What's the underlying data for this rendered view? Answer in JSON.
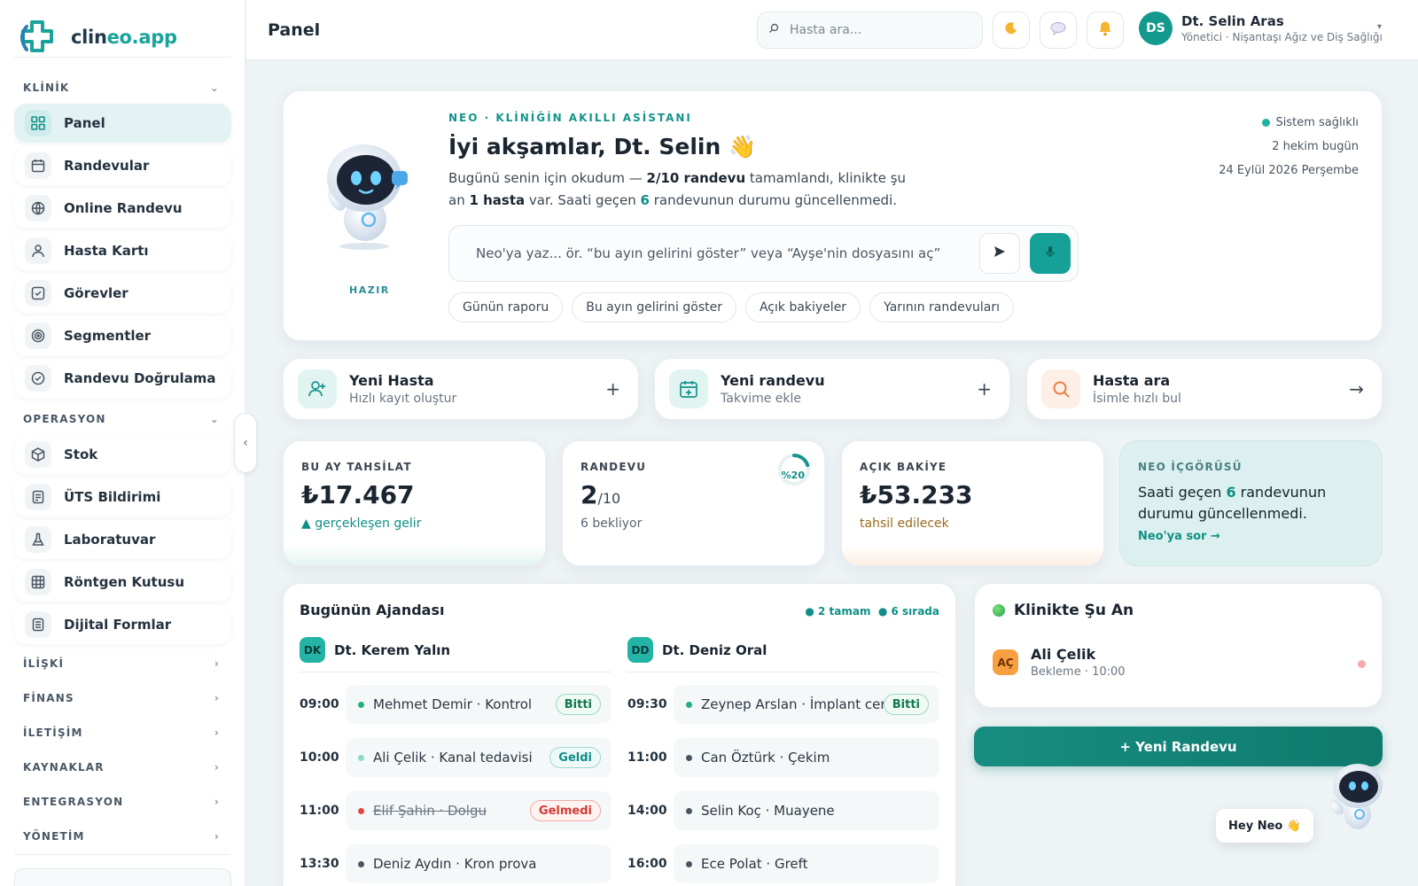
{
  "brand": {
    "name_a": "clin",
    "name_b": "eo.app"
  },
  "sidebar": {
    "sections": [
      {
        "label": "KLİNİK"
      },
      {
        "label": "OPERASYON"
      },
      {
        "label": "İLİŞKİ"
      },
      {
        "label": "FİNANS"
      },
      {
        "label": "İLETİŞİM"
      },
      {
        "label": "KAYNAKLAR"
      },
      {
        "label": "ENTEGRASYON"
      },
      {
        "label": "YÖNETİM"
      }
    ],
    "items": [
      {
        "label": "Panel",
        "icon": "dashboard-icon",
        "active": true
      },
      {
        "label": "Randevular",
        "icon": "calendar-icon"
      },
      {
        "label": "Online Randevu",
        "icon": "globe-icon"
      },
      {
        "label": "Hasta Kartı",
        "icon": "user-icon"
      },
      {
        "label": "Görevler",
        "icon": "checkbox-icon"
      },
      {
        "label": "Segmentler",
        "icon": "target-icon"
      },
      {
        "label": "Randevu Doğrulama",
        "icon": "check-circle-icon"
      },
      {
        "label": "Stok",
        "icon": "box-icon"
      },
      {
        "label": "ÜTS Bildirimi",
        "icon": "document-icon"
      },
      {
        "label": "Laboratuvar",
        "icon": "flask-icon"
      },
      {
        "label": "Röntgen Kutusu",
        "icon": "grid-icon"
      },
      {
        "label": "Dijital Formlar",
        "icon": "form-icon"
      }
    ]
  },
  "topbar": {
    "title": "Panel",
    "search_placeholder": "Hasta ara...",
    "user": {
      "initials": "DS",
      "name": "Dt. Selin Aras",
      "role": "Yönetici · Nişantaşı Ağız ve Diş Sağlığı"
    }
  },
  "hero": {
    "tag": "NEO · KLİNİĞİN AKILLI ASİSTANI",
    "greeting": "İyi akşamlar, Dt. Selin 👋",
    "desc_1": "Bugünü senin için okudum — ",
    "desc_2": "2/10 randevu",
    "desc_3": " tamamlandı, klinikte şu an ",
    "desc_4": "1 hasta",
    "desc_5": " var. Saati geçen ",
    "desc_6": "6",
    "desc_7": " randevunun durumu güncellenmedi.",
    "robot_status": "HAZIR",
    "input_placeholder": "Neo'ya yaz...  ör. “bu ayın gelirini göster” veya “Ayşe'nin dosyasını aç”",
    "chips": [
      "Günün raporu",
      "Bu ayın gelirini göster",
      "Açık bakiyeler",
      "Yarının randevuları"
    ],
    "system_status": "Sistem sağlıklı",
    "doctors_today": "2 hekim bugün",
    "date": "24 Eylül 2026 Perşembe"
  },
  "quick_actions": [
    {
      "title": "Yeni Hasta",
      "sub": "Hızlı kayıt oluştur",
      "action": "+"
    },
    {
      "title": "Yeni randevu",
      "sub": "Takvime ekle",
      "action": "+"
    },
    {
      "title": "Hasta ara",
      "sub": "İsimle hızlı bul",
      "action": "→"
    }
  ],
  "stats": {
    "collection": {
      "label": "BU AY TAHSİLAT",
      "value": "₺17.467",
      "sub": "▲ gerçekleşen gelir"
    },
    "appointments": {
      "label": "RANDEVU",
      "value": "2",
      "total": "/10",
      "sub": "6 bekliyor",
      "ring_pct": "%20",
      "ring_fraction": 0.2
    },
    "balance": {
      "label": "AÇIK BAKİYE",
      "value": "₺53.233",
      "sub": "tahsil edilecek"
    },
    "insight": {
      "label": "NEO İÇGÖRÜSÜ",
      "text_1": "Saati geçen ",
      "text_2": "6",
      "text_3": " randevunun durumu güncellenmedi.",
      "link": "Neo'ya sor →"
    }
  },
  "agenda": {
    "title": "Bugünün Ajandası",
    "legend_done": "● 2 tamam",
    "legend_queue": "● 6 sırada",
    "doctors": [
      {
        "initials": "DK",
        "name": "Dt. Kerem Yalın",
        "slots": [
          {
            "time": "09:00",
            "text": "Mehmet Demir · Kontrol",
            "status": "Bitti",
            "dot": "#22b07d"
          },
          {
            "time": "10:00",
            "text": "Ali Çelik · Kanal tedavisi",
            "status": "Geldi",
            "dot": "#8fd7c9"
          },
          {
            "time": "11:00",
            "text": "Elif Şahin · Dolgu",
            "status": "Gelmedi",
            "dot": "#e0473e",
            "strike": true
          },
          {
            "time": "13:30",
            "text": "Deniz Aydın · Kron prova",
            "status": "",
            "dot": "#4a5562"
          }
        ]
      },
      {
        "initials": "DD",
        "name": "Dt. Deniz Oral",
        "slots": [
          {
            "time": "09:30",
            "text": "Zeynep Arslan · İmplant cerr...",
            "status": "Bitti",
            "dot": "#22b07d"
          },
          {
            "time": "11:00",
            "text": "Can Öztürk · Çekim",
            "status": "",
            "dot": "#4a5562"
          },
          {
            "time": "14:00",
            "text": "Selin Koç · Muayene",
            "status": "",
            "dot": "#4a5562"
          },
          {
            "time": "16:00",
            "text": "Ece Polat · Greft",
            "status": "",
            "dot": "#4a5562"
          }
        ]
      }
    ]
  },
  "now": {
    "title": "Klinikte Şu An",
    "patient_initials": "AÇ",
    "patient_name": "Ali Çelik",
    "patient_status": "Bekleme · 10:00"
  },
  "new_appointment_button": "+ Yeni Randevu",
  "neo_float": "Hey Neo 👋",
  "colors": {
    "accent": "#15a098",
    "done": "#0f8f86",
    "danger": "#e0473e"
  }
}
